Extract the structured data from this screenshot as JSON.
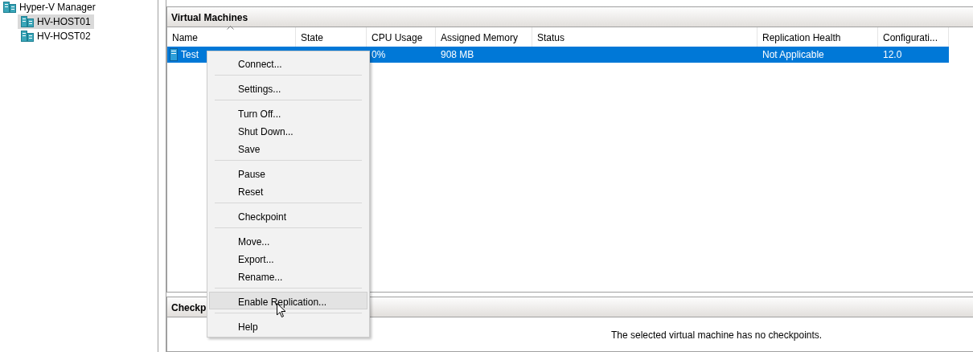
{
  "tree": {
    "items": [
      {
        "label": "Hyper-V Manager",
        "children": [
          {
            "label": "HV-HOST01",
            "selected": true
          },
          {
            "label": "HV-HOST02",
            "selected": false
          }
        ]
      }
    ]
  },
  "vm_panel": {
    "title": "Virtual Machines",
    "columns": [
      {
        "label": "Name",
        "sorted": true
      },
      {
        "label": "State",
        "sorted": false
      },
      {
        "label": "CPU Usage",
        "sorted": false
      },
      {
        "label": "Assigned Memory",
        "sorted": false
      },
      {
        "label": "Status",
        "sorted": false
      },
      {
        "label": "Replication Health",
        "sorted": false
      },
      {
        "label": "Configurati...",
        "sorted": false
      }
    ],
    "rows": [
      {
        "selected": true,
        "cells": [
          "Test",
          null,
          "0%",
          "908 MB",
          null,
          "Not Applicable",
          "12.0"
        ]
      }
    ]
  },
  "context_menu": {
    "items": [
      {
        "kind": "item",
        "label": "Connect...",
        "hovered": false
      },
      {
        "kind": "separator"
      },
      {
        "kind": "item",
        "label": "Settings...",
        "hovered": false
      },
      {
        "kind": "separator"
      },
      {
        "kind": "item",
        "label": "Turn Off...",
        "hovered": false
      },
      {
        "kind": "item",
        "label": "Shut Down...",
        "hovered": false
      },
      {
        "kind": "item",
        "label": "Save",
        "hovered": false
      },
      {
        "kind": "separator"
      },
      {
        "kind": "item",
        "label": "Pause",
        "hovered": false
      },
      {
        "kind": "item",
        "label": "Reset",
        "hovered": false
      },
      {
        "kind": "separator"
      },
      {
        "kind": "item",
        "label": "Checkpoint",
        "hovered": false
      },
      {
        "kind": "separator"
      },
      {
        "kind": "item",
        "label": "Move...",
        "hovered": false
      },
      {
        "kind": "item",
        "label": "Export...",
        "hovered": false
      },
      {
        "kind": "item",
        "label": "Rename...",
        "hovered": false
      },
      {
        "kind": "separator"
      },
      {
        "kind": "item",
        "label": "Enable Replication...",
        "hovered": true
      },
      {
        "kind": "separator"
      },
      {
        "kind": "item",
        "label": "Help",
        "hovered": false
      }
    ]
  },
  "checkpoints_panel": {
    "title": "Checkp",
    "message": "The selected virtual machine has no checkpoints."
  }
}
